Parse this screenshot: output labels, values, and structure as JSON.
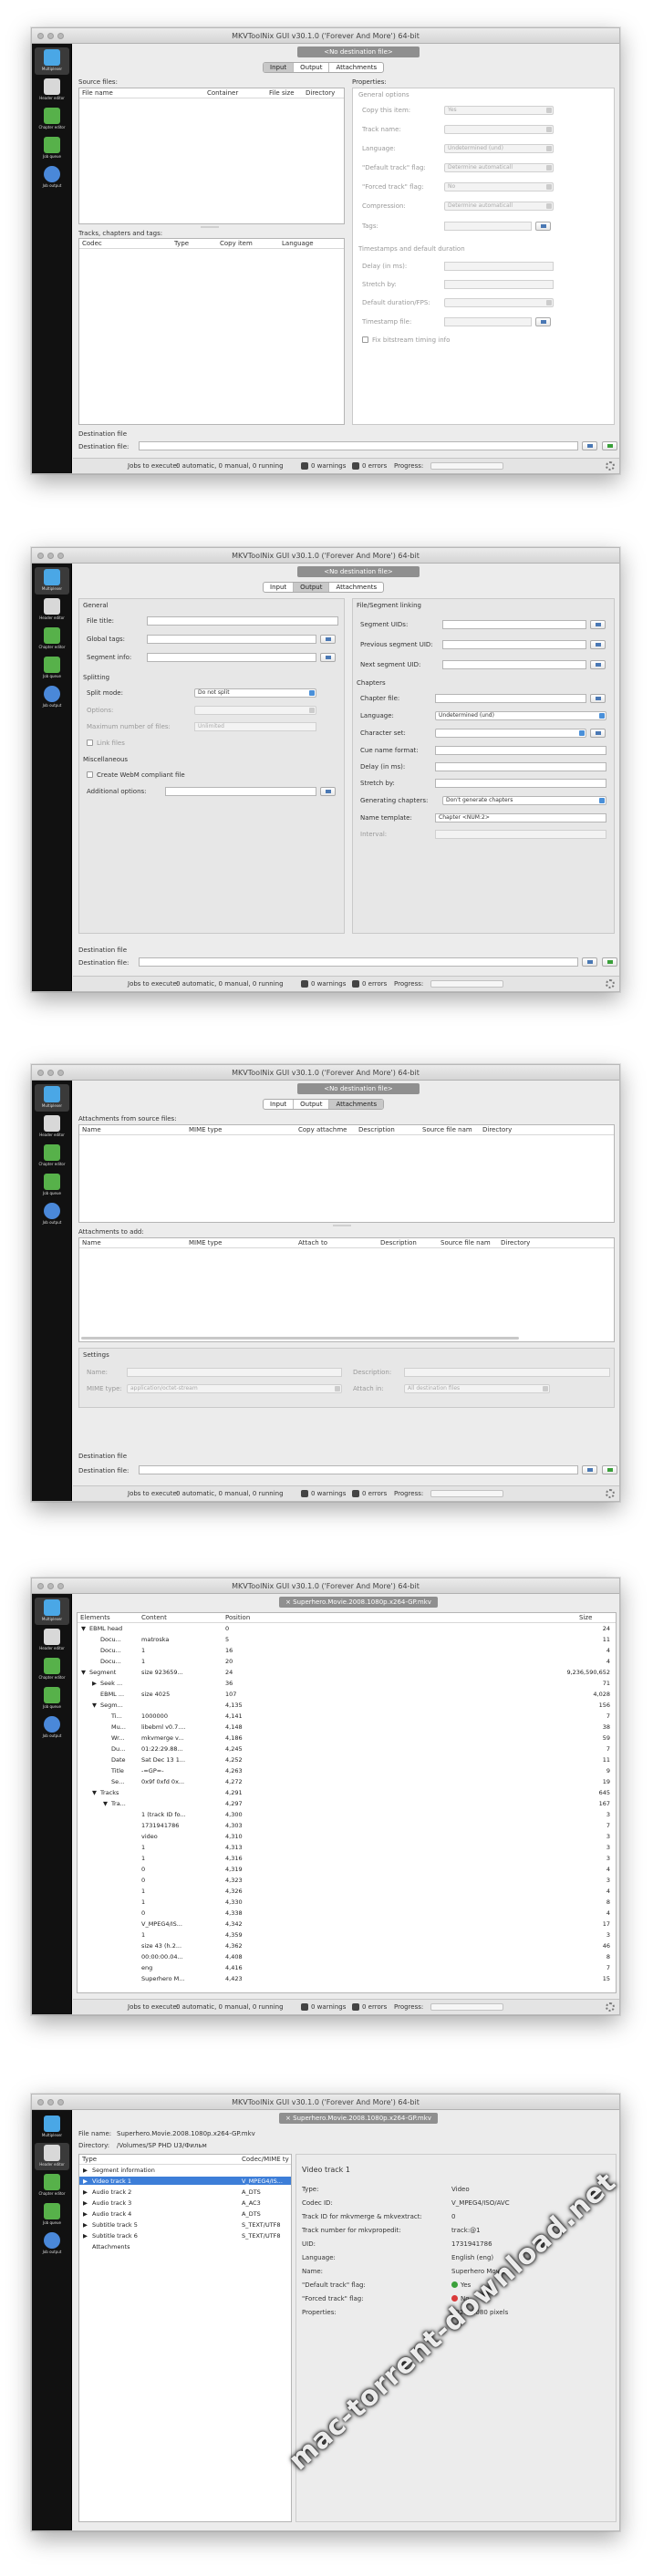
{
  "app_title": "MKVToolNix GUI v30.1.0 ('Forever And More') 64-bit",
  "sidebar": {
    "items": [
      "Multiplexer",
      "Header editor",
      "Chapter editor",
      "Job queue",
      "Job output"
    ]
  },
  "colors": {
    "sidebar_bg": "#111111",
    "window_bg": "#ececec",
    "selection": "#3d7ed8",
    "yes": "#3aa03a",
    "no": "#d93a3a"
  },
  "common": {
    "no_destination": "<No destination file>",
    "tabs": [
      "Input",
      "Output",
      "Attachments"
    ],
    "destination_file_group": "Destination file",
    "destination_file_label": "Destination file:",
    "jobs_label": "Jobs to execute:",
    "jobs_value": "0 automatic, 0 manual, 0 running",
    "warnings": "0 warnings",
    "errors": "0 errors",
    "progress_label": "Progress:"
  },
  "input_tab": {
    "source_files": "Source files:",
    "source_columns": [
      "File name",
      "Container",
      "File size",
      "Directory"
    ],
    "tracks_label": "Tracks, chapters and tags:",
    "track_columns": [
      "Codec",
      "Type",
      "Copy item",
      "Language"
    ],
    "properties_label": "Properties:",
    "general_options": "General options",
    "props": [
      {
        "label": "Copy this item:",
        "value": "Yes",
        "kind": "select"
      },
      {
        "label": "Track name:",
        "value": "",
        "kind": "select"
      },
      {
        "label": "Language:",
        "value": "Undetermined (und)",
        "kind": "select"
      },
      {
        "label": "\"Default track\" flag:",
        "value": "Determine automaticall",
        "kind": "select"
      },
      {
        "label": "\"Forced track\" flag:",
        "value": "No",
        "kind": "select"
      },
      {
        "label": "Compression:",
        "value": "Determine automaticall",
        "kind": "select"
      },
      {
        "label": "Tags:",
        "value": "",
        "kind": "input-btn"
      }
    ],
    "timestamps_group": "Timestamps and default duration",
    "ts_props": [
      "Delay (in ms):",
      "Stretch by:",
      "Default duration/FPS:",
      "Timestamp file:"
    ],
    "fix_bitstream": "Fix bitstream timing info"
  },
  "output_tab": {
    "general": "General",
    "file_title": "File title:",
    "global_tags": "Global tags:",
    "segment_info": "Segment info:",
    "splitting": "Splitting",
    "split_mode": "Split mode:",
    "split_mode_value": "Do not split",
    "options": "Options:",
    "max_files": "Maximum number of files:",
    "max_files_value": "Unlimited",
    "link_files": "Link files",
    "misc": "Miscellaneous",
    "webm": "Create WebM compliant file",
    "additional_options": "Additional options:",
    "file_segment_linking": "File/Segment linking",
    "segment_uids": "Segment UIDs:",
    "prev_segment_uid": "Previous segment UID:",
    "next_segment_uid": "Next segment UID:",
    "chapters": "Chapters",
    "chapter_file": "Chapter file:",
    "language": "Language:",
    "language_value": "Undetermined (und)",
    "character_set": "Character set:",
    "cue_name_format": "Cue name format:",
    "delay_ms": "Delay (in ms):",
    "stretch_by": "Stretch by:",
    "generating_chapters": "Generating chapters:",
    "generating_value": "Don't generate chapters",
    "name_template": "Name template:",
    "name_template_value": "Chapter <NUM:2>",
    "interval": "Interval:"
  },
  "attachments_tab": {
    "from_source": "Attachments from source files:",
    "source_columns": [
      "Name",
      "MIME type",
      "Copy attachme",
      "Description",
      "Source file nam",
      "Directory"
    ],
    "to_add": "Attachments to add:",
    "add_columns": [
      "Name",
      "MIME type",
      "Attach to",
      "Description",
      "Source file nam",
      "Directory"
    ],
    "settings": "Settings",
    "name_label": "Name:",
    "description_label": "Description:",
    "mime_label": "MIME type:",
    "mime_value": "application/octet-stream",
    "attach_in_label": "Attach in:",
    "attach_in_value": "All destination files"
  },
  "info_tool": {
    "file_chip": "Superhero.Movie.2008.1080p.x264-GP.mkv",
    "columns": [
      "Elements",
      "Content",
      "Position",
      "Size"
    ],
    "rows": [
      {
        "indent": 0,
        "arrow": "▼",
        "element": "EBML head",
        "content": "",
        "position": "0",
        "size": "24"
      },
      {
        "indent": 1,
        "arrow": "",
        "element": "Docu...",
        "content": "matroska",
        "position": "5",
        "size": "11"
      },
      {
        "indent": 1,
        "arrow": "",
        "element": "Docu...",
        "content": "1",
        "position": "16",
        "size": "4"
      },
      {
        "indent": 1,
        "arrow": "",
        "element": "Docu...",
        "content": "1",
        "position": "20",
        "size": "4"
      },
      {
        "indent": 0,
        "arrow": "▼",
        "element": "Segment",
        "content": "size 923659...",
        "position": "24",
        "size": "9,236,590,652"
      },
      {
        "indent": 1,
        "arrow": "▶",
        "element": "Seek ...",
        "content": "",
        "position": "36",
        "size": "71"
      },
      {
        "indent": 1,
        "arrow": "",
        "element": "EBML ...",
        "content": "size 4025",
        "position": "107",
        "size": "4,028"
      },
      {
        "indent": 1,
        "arrow": "▼",
        "element": "Segm...",
        "content": "",
        "position": "4,135",
        "size": "156"
      },
      {
        "indent": 2,
        "arrow": "",
        "element": "Ti...",
        "content": "1000000",
        "position": "4,141",
        "size": "7"
      },
      {
        "indent": 2,
        "arrow": "",
        "element": "Mu...",
        "content": "libebml v0.7....",
        "position": "4,148",
        "size": "38"
      },
      {
        "indent": 2,
        "arrow": "",
        "element": "Wr...",
        "content": "mkvmerge v...",
        "position": "4,186",
        "size": "59"
      },
      {
        "indent": 2,
        "arrow": "",
        "element": "Du...",
        "content": "01:22:29.88...",
        "position": "4,245",
        "size": "7"
      },
      {
        "indent": 2,
        "arrow": "",
        "element": "Date",
        "content": "Sat Dec 13 1...",
        "position": "4,252",
        "size": "11"
      },
      {
        "indent": 2,
        "arrow": "",
        "element": "Title",
        "content": "-=GP=-",
        "position": "4,263",
        "size": "9"
      },
      {
        "indent": 2,
        "arrow": "",
        "element": "Se...",
        "content": "0x9f 0xfd 0x...",
        "position": "4,272",
        "size": "19"
      },
      {
        "indent": 1,
        "arrow": "▼",
        "element": "Tracks",
        "content": "",
        "position": "4,291",
        "size": "645"
      },
      {
        "indent": 2,
        "arrow": "▼",
        "element": "Tra...",
        "content": "",
        "position": "4,297",
        "size": "167"
      },
      {
        "indent": 3,
        "arrow": "",
        "element": "",
        "content": "1 (track ID fo...",
        "position": "4,300",
        "size": "3"
      },
      {
        "indent": 3,
        "arrow": "",
        "element": "",
        "content": "1731941786",
        "position": "4,303",
        "size": "7"
      },
      {
        "indent": 3,
        "arrow": "",
        "element": "",
        "content": "video",
        "position": "4,310",
        "size": "3"
      },
      {
        "indent": 3,
        "arrow": "",
        "element": "",
        "content": "1",
        "position": "4,313",
        "size": "3"
      },
      {
        "indent": 3,
        "arrow": "",
        "element": "",
        "content": "1",
        "position": "4,316",
        "size": "3"
      },
      {
        "indent": 3,
        "arrow": "",
        "element": "",
        "content": "0",
        "position": "4,319",
        "size": "4"
      },
      {
        "indent": 3,
        "arrow": "",
        "element": "",
        "content": "0",
        "position": "4,323",
        "size": "3"
      },
      {
        "indent": 3,
        "arrow": "",
        "element": "",
        "content": "1",
        "position": "4,326",
        "size": "4"
      },
      {
        "indent": 3,
        "arrow": "",
        "element": "",
        "content": "1",
        "position": "4,330",
        "size": "8"
      },
      {
        "indent": 3,
        "arrow": "",
        "element": "",
        "content": "0",
        "position": "4,338",
        "size": "4"
      },
      {
        "indent": 3,
        "arrow": "",
        "element": "",
        "content": "V_MPEG4/IS...",
        "position": "4,342",
        "size": "17"
      },
      {
        "indent": 3,
        "arrow": "",
        "element": "",
        "content": "1",
        "position": "4,359",
        "size": "3"
      },
      {
        "indent": 3,
        "arrow": "",
        "element": "",
        "content": "size 43 (h.2...",
        "position": "4,362",
        "size": "46"
      },
      {
        "indent": 3,
        "arrow": "",
        "element": "",
        "content": "00:00:00.04...",
        "position": "4,408",
        "size": "8"
      },
      {
        "indent": 3,
        "arrow": "",
        "element": "",
        "content": "eng",
        "position": "4,416",
        "size": "7"
      },
      {
        "indent": 3,
        "arrow": "",
        "element": "",
        "content": "Superhero M...",
        "position": "4,423",
        "size": "15"
      }
    ]
  },
  "header_editor": {
    "file_chip": "Superhero.Movie.2008.1080p.x264-GP.mkv",
    "file_name_label": "File name:",
    "file_name_value": "Superhero.Movie.2008.1080p.x264-GP.mkv",
    "directory_label": "Directory:",
    "directory_value": "/Volumes/SP PHD U3/Фильм",
    "columns": [
      "Type",
      "Codec/MIME ty"
    ],
    "rows": [
      {
        "type": "Segment information",
        "codec": "",
        "selected": false
      },
      {
        "type": "Video track 1",
        "codec": "V_MPEG4/IS...",
        "selected": true
      },
      {
        "type": "Audio track 2",
        "codec": "A_DTS",
        "selected": false
      },
      {
        "type": "Audio track 3",
        "codec": "A_AC3",
        "selected": false
      },
      {
        "type": "Audio track 4",
        "codec": "A_DTS",
        "selected": false
      },
      {
        "type": "Subtitle track 5",
        "codec": "S_TEXT/UTF8",
        "selected": false
      },
      {
        "type": "Subtitle track 6",
        "codec": "S_TEXT/UTF8",
        "selected": false
      },
      {
        "type": "Attachments",
        "codec": "",
        "selected": false
      }
    ],
    "detail_title": "Video track 1",
    "details": [
      {
        "label": "Type:",
        "value": "Video"
      },
      {
        "label": "Codec ID:",
        "value": "V_MPEG4/ISO/AVC"
      },
      {
        "label": "Track ID for mkvmerge & mkvextract:",
        "value": "0"
      },
      {
        "label": "Track number for mkvpropedit:",
        "value": "track:@1"
      },
      {
        "label": "UID:",
        "value": "1731941786"
      },
      {
        "label": "Language:",
        "value": "English (eng)"
      },
      {
        "label": "Name:",
        "value": "Superhero Movie"
      },
      {
        "label": "\"Default track\" flag:",
        "value": "Yes"
      },
      {
        "label": "\"Forced track\" flag:",
        "value": "No"
      },
      {
        "label": "Properties:",
        "value": "1920x1080 pixels"
      }
    ]
  },
  "watermark": "mac-torrent-download.net"
}
